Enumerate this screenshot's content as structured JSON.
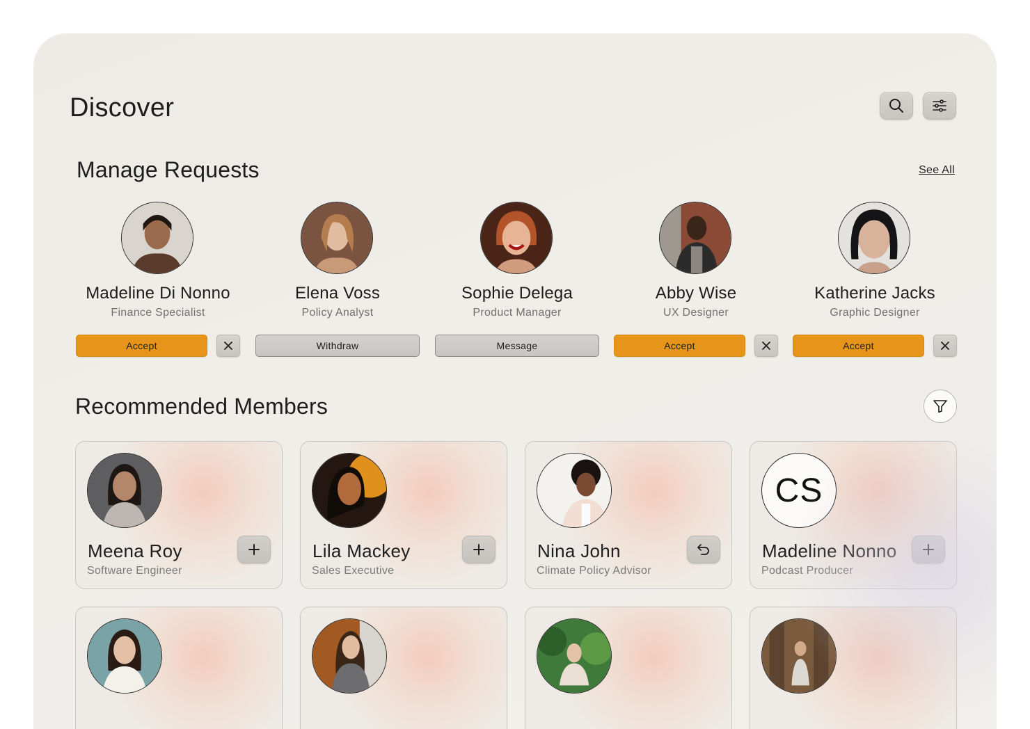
{
  "page": {
    "title": "Discover"
  },
  "top_actions": {
    "search_icon": "search-icon",
    "settings_icon": "sliders-icon"
  },
  "requests": {
    "title": "Manage Requests",
    "see_all": "See All",
    "items": [
      {
        "name": "Madeline Di Nonno",
        "role": "Finance Specialist",
        "action": "Accept",
        "kind": "accept",
        "dismiss": true
      },
      {
        "name": "Elena Voss",
        "role": "Policy Analyst",
        "action": "Withdraw",
        "kind": "gray",
        "dismiss": false
      },
      {
        "name": "Sophie Delega",
        "role": "Product Manager",
        "action": "Message",
        "kind": "gray",
        "dismiss": false
      },
      {
        "name": "Abby Wise",
        "role": "UX Designer",
        "action": "Accept",
        "kind": "accept",
        "dismiss": true
      },
      {
        "name": "Katherine Jacks",
        "role": "Graphic Designer",
        "action": "Accept",
        "kind": "accept",
        "dismiss": true
      }
    ]
  },
  "recommended": {
    "title": "Recommended Members",
    "filter_icon": "funnel-icon",
    "members": [
      {
        "name": "Meena Roy",
        "role": "Software Engineer",
        "action_icon": "plus-icon"
      },
      {
        "name": "Lila Mackey",
        "role": "Sales Executive",
        "action_icon": "plus-icon"
      },
      {
        "name": "Nina John",
        "role": "Climate Policy Advisor",
        "action_icon": "undo-icon"
      },
      {
        "name": "Madeline Nonno",
        "role": "Podcast Producer",
        "action_icon": "plus-icon",
        "initials": "CS"
      },
      {
        "name": "",
        "role": ""
      },
      {
        "name": "",
        "role": ""
      },
      {
        "name": "",
        "role": ""
      },
      {
        "name": "",
        "role": ""
      }
    ]
  },
  "colors": {
    "accent": "#e6951a",
    "background": "#f0eee9"
  }
}
